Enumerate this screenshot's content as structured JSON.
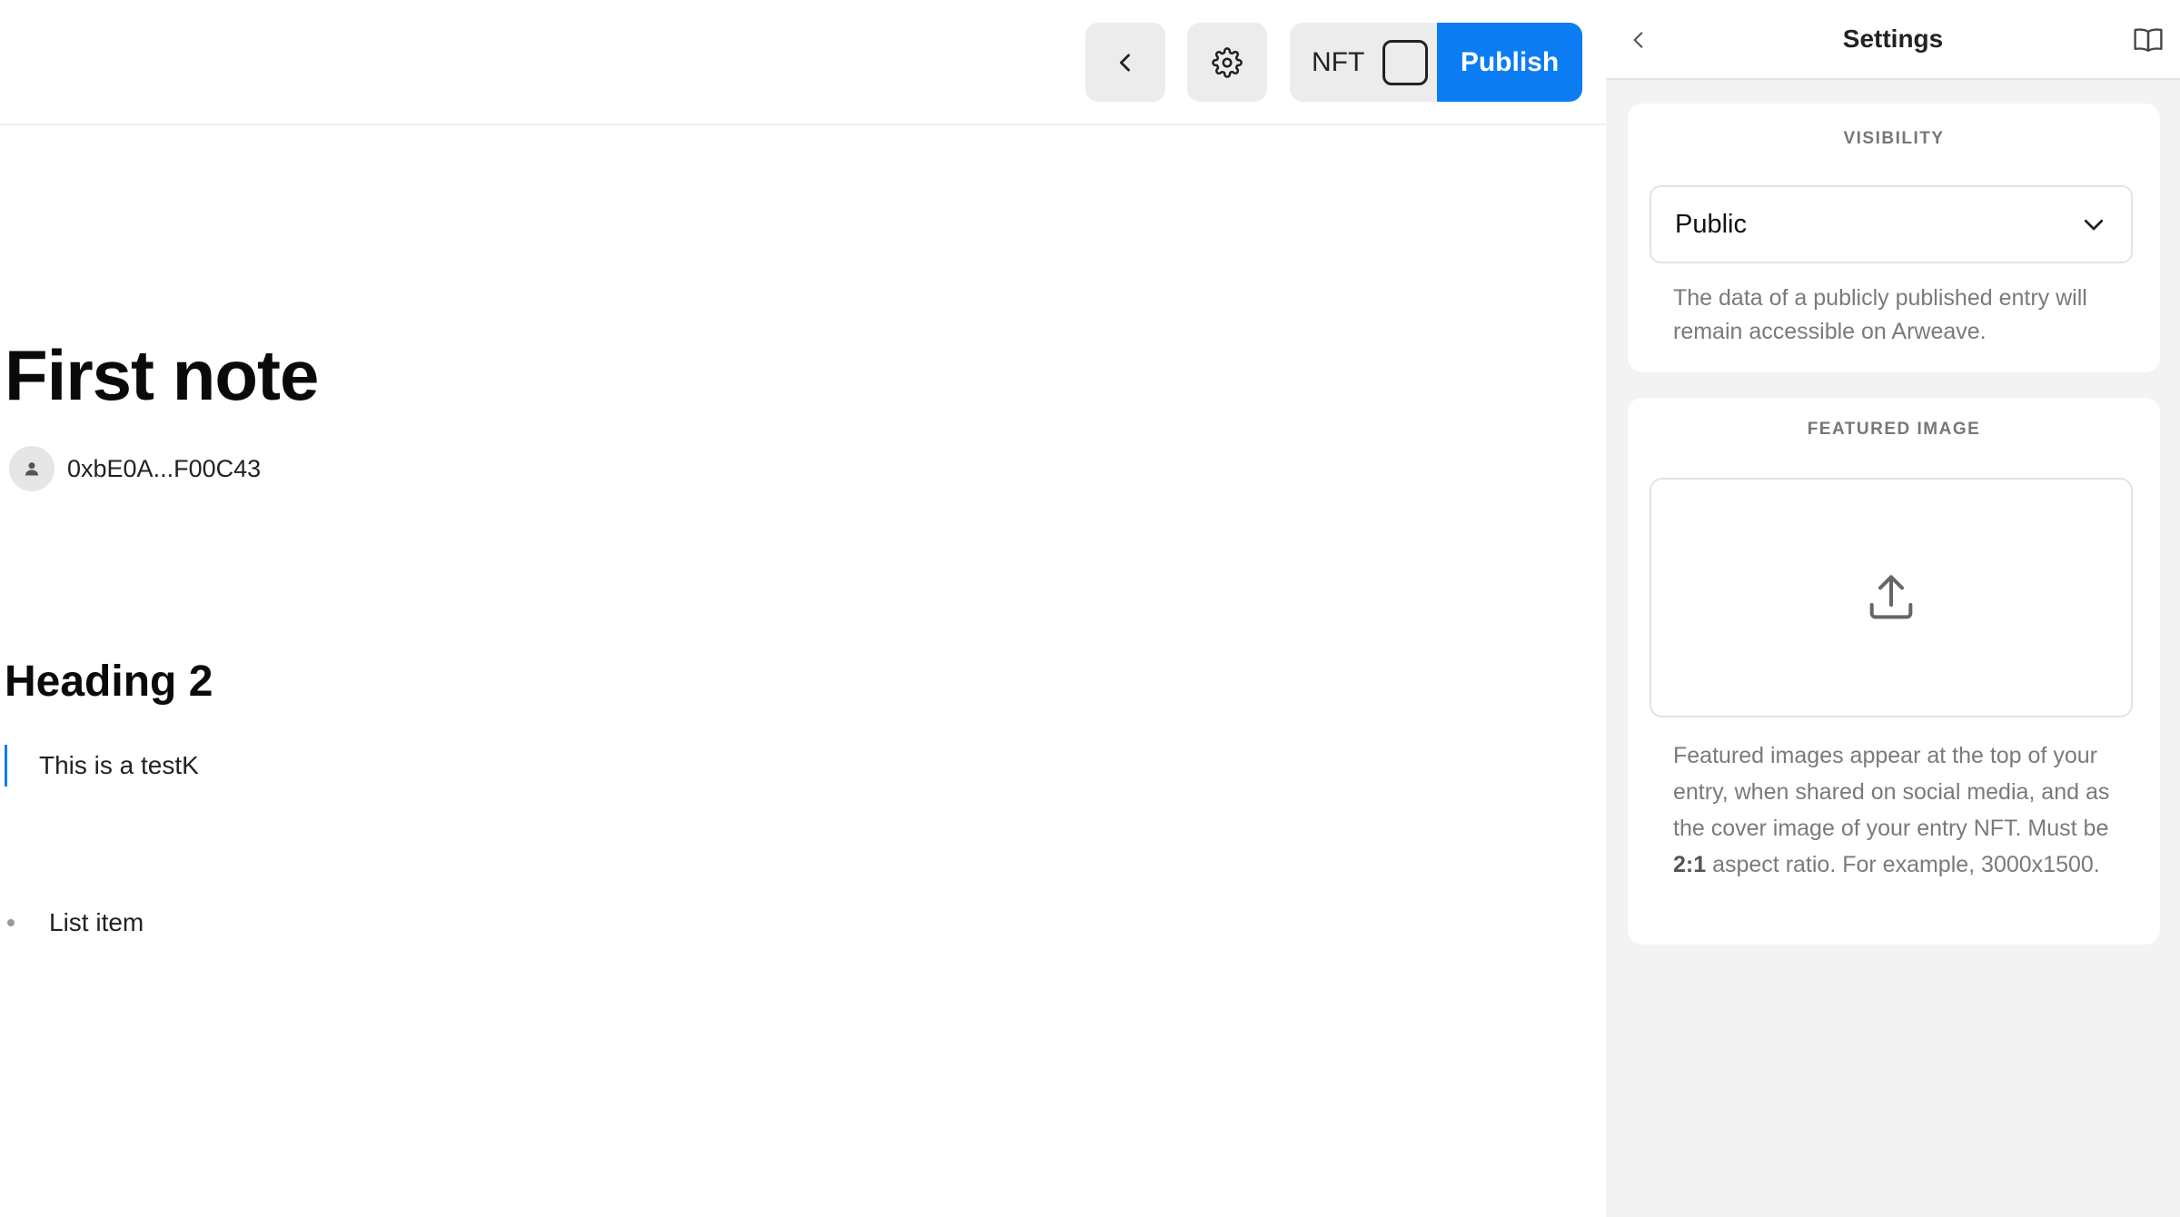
{
  "toolbar": {
    "back_icon": "chevron-left-icon",
    "settings_icon": "gear-icon",
    "nft_label": "NFT",
    "publish_label": "Publish"
  },
  "document": {
    "title": "First note",
    "author_address": "0xbE0A...F00C43",
    "heading_2": "Heading 2",
    "quote": "This is a testK",
    "list_items": [
      "List item"
    ]
  },
  "settings_panel": {
    "title": "Settings",
    "visibility": {
      "label": "VISIBILITY",
      "selected": "Public",
      "description": "The data of a publicly published entry will remain accessible on Arweave."
    },
    "featured_image": {
      "label": "FEATURED IMAGE",
      "description_part1": "Featured images appear at the top of your entry, when shared on social media, and as the cover image of your entry NFT. Must be ",
      "description_ratio": "2:1",
      "description_part2": " aspect ratio. For example, 3000x1500."
    }
  },
  "colors": {
    "accent": "#0b7cf2",
    "panel_bg": "#f3f3f3",
    "button_bg": "#ececec",
    "muted_text": "#7a7a7a"
  }
}
